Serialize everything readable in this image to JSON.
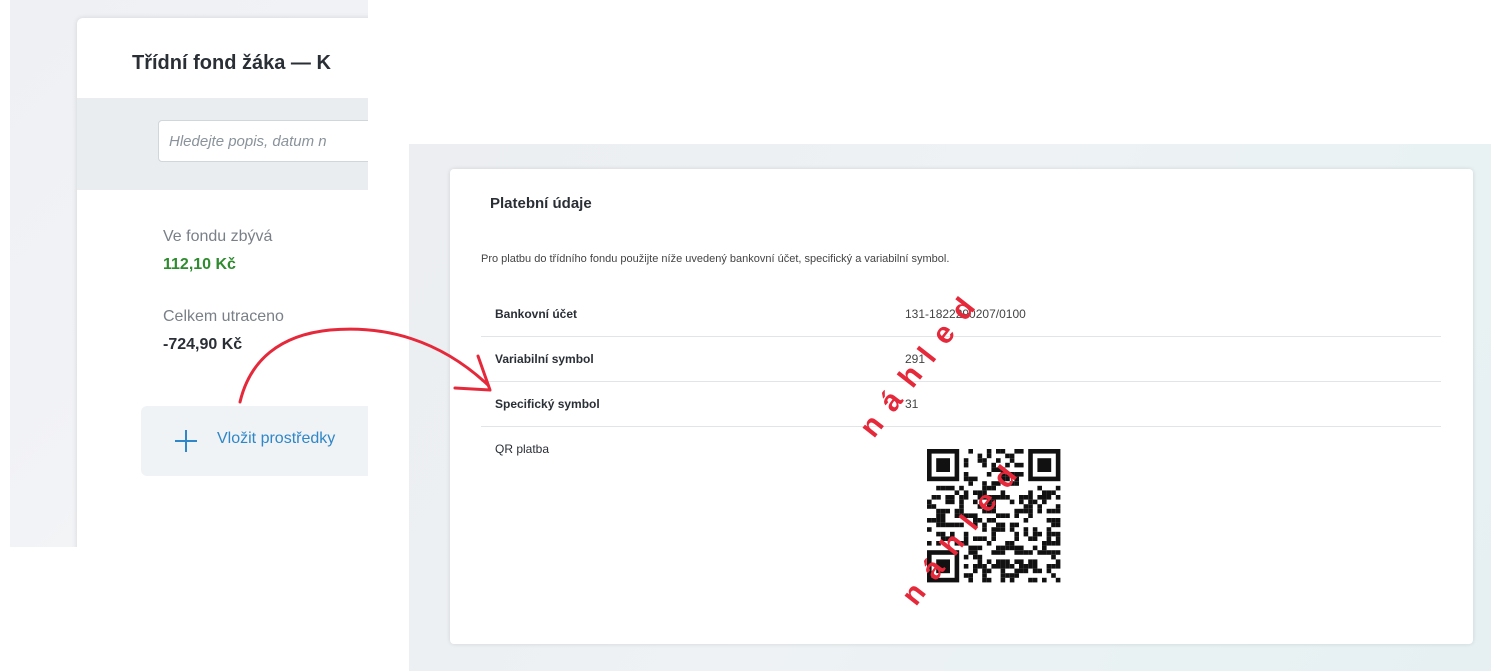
{
  "left_panel": {
    "title": "Třídní fond žáka — K",
    "search_placeholder": "Hledejte popis, datum n",
    "remaining_label": "Ve fondu zbývá",
    "remaining_value": "112,10 Kč",
    "spent_label": "Celkem utraceno",
    "spent_value": "-724,90 Kč",
    "deposit_button": "Vložit prostředky",
    "deposit_icon": "plus-icon"
  },
  "payment": {
    "title": "Platební údaje",
    "description": "Pro platbu do třídního fondu použijte níže uvedený bankovní účet, specifický a variabilní symbol.",
    "rows": [
      {
        "label": "Bankovní účet",
        "value": "131-1822290207/0100"
      },
      {
        "label": "Variabilní symbol",
        "value": "291"
      },
      {
        "label": "Specifický symbol",
        "value": "31"
      },
      {
        "label": "QR platba",
        "value": ""
      }
    ]
  },
  "watermarks": [
    "náhled",
    "náhled"
  ],
  "colors": {
    "accent_blue": "#2f86c8",
    "positive_green": "#2e8b2e",
    "negative_text": "#2a2f36",
    "watermark_red": "#e5283a",
    "arrow_red": "#e5283a"
  }
}
